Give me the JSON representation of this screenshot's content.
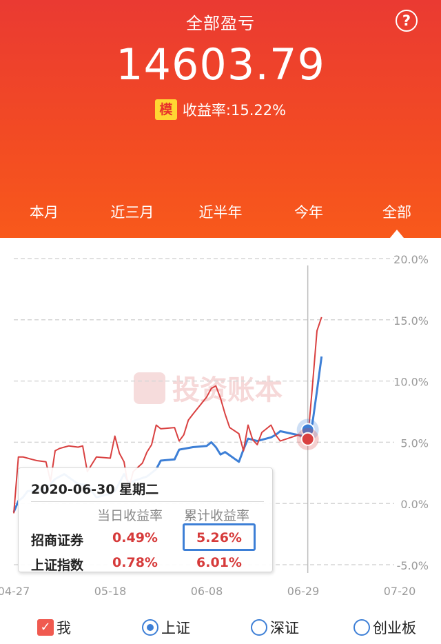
{
  "header": {
    "title": "全部盈亏",
    "help_icon_glyph": "?",
    "total": "14603.79",
    "mo_badge": "模",
    "yield_text": "收益率:15.22%"
  },
  "tabs": [
    {
      "label": "本月"
    },
    {
      "label": "近三月"
    },
    {
      "label": "近半年"
    },
    {
      "label": "今年"
    },
    {
      "label": "全部"
    }
  ],
  "watermark": "投资账本",
  "chart_data": {
    "type": "line",
    "ylim": [
      -5,
      20
    ],
    "yticks": [
      "20.0%",
      "15.0%",
      "10.0%",
      "5.0%",
      "0.0%",
      "-5.0%"
    ],
    "xticks": [
      "04-27",
      "05-18",
      "06-08",
      "06-29",
      "07-20"
    ],
    "grid": true,
    "xlim": [
      "2020-04-27",
      "2020-07-26"
    ],
    "series": [
      {
        "name": "我",
        "color": "#d94040",
        "points": [
          [
            "2020-04-27",
            -0.8
          ],
          [
            "2020-04-28",
            3.8
          ],
          [
            "2020-04-29",
            3.8
          ],
          [
            "2020-04-30",
            3.7
          ],
          [
            "2020-05-01",
            3.6
          ],
          [
            "2020-05-02",
            3.5
          ],
          [
            "2020-05-04",
            3.4
          ],
          [
            "2020-05-05",
            1.8
          ],
          [
            "2020-05-06",
            4.3
          ],
          [
            "2020-05-07",
            4.5
          ],
          [
            "2020-05-08",
            4.6
          ],
          [
            "2020-05-09",
            4.7
          ],
          [
            "2020-05-11",
            4.6
          ],
          [
            "2020-05-12",
            4.7
          ],
          [
            "2020-05-13",
            2.6
          ],
          [
            "2020-05-14",
            3.2
          ],
          [
            "2020-05-15",
            3.8
          ],
          [
            "2020-05-18",
            3.7
          ],
          [
            "2020-05-19",
            5.5
          ],
          [
            "2020-05-20",
            4.1
          ],
          [
            "2020-05-21",
            3.4
          ],
          [
            "2020-05-22",
            1.2
          ],
          [
            "2020-05-23",
            2.6
          ],
          [
            "2020-05-25",
            3.3
          ],
          [
            "2020-05-26",
            4.2
          ],
          [
            "2020-05-27",
            4.8
          ],
          [
            "2020-05-28",
            6.4
          ],
          [
            "2020-05-29",
            6.1
          ],
          [
            "2020-06-01",
            6.2
          ],
          [
            "2020-06-02",
            5.1
          ],
          [
            "2020-06-03",
            5.6
          ],
          [
            "2020-06-04",
            6.8
          ],
          [
            "2020-06-05",
            7.3
          ],
          [
            "2020-06-08",
            8.7
          ],
          [
            "2020-06-09",
            9.4
          ],
          [
            "2020-06-10",
            9.6
          ],
          [
            "2020-06-11",
            8.6
          ],
          [
            "2020-06-12",
            7.3
          ],
          [
            "2020-06-13",
            6.2
          ],
          [
            "2020-06-15",
            5.7
          ],
          [
            "2020-06-16",
            4.3
          ],
          [
            "2020-06-17",
            6.4
          ],
          [
            "2020-06-18",
            5.2
          ],
          [
            "2020-06-19",
            4.8
          ],
          [
            "2020-06-20",
            5.8
          ],
          [
            "2020-06-22",
            6.4
          ],
          [
            "2020-06-23",
            5.6
          ],
          [
            "2020-06-24",
            5.1
          ],
          [
            "2020-06-28",
            5.6
          ],
          [
            "2020-06-29",
            5.4
          ],
          [
            "2020-06-30",
            5.26
          ],
          [
            "2020-07-01",
            9.5
          ],
          [
            "2020-07-02",
            14.1
          ],
          [
            "2020-07-03",
            15.22
          ]
        ]
      },
      {
        "name": "上证",
        "color": "#3d7fd6",
        "points": [
          [
            "2020-04-27",
            -0.7
          ],
          [
            "2020-04-28",
            0.2
          ],
          [
            "2020-04-29",
            0.5
          ],
          [
            "2020-04-30",
            1.0
          ],
          [
            "2020-05-04",
            1.2
          ],
          [
            "2020-05-05",
            1.6
          ],
          [
            "2020-05-06",
            2.0
          ],
          [
            "2020-05-07",
            2.2
          ],
          [
            "2020-05-08",
            2.4
          ],
          [
            "2020-05-11",
            1.6
          ],
          [
            "2020-05-13",
            1.5
          ],
          [
            "2020-05-15",
            0.5
          ],
          [
            "2020-05-18",
            0.8
          ],
          [
            "2020-05-19",
            1.0
          ],
          [
            "2020-05-21",
            2.4
          ],
          [
            "2020-05-22",
            1.7
          ],
          [
            "2020-05-26",
            2.2
          ],
          [
            "2020-05-28",
            2.8
          ],
          [
            "2020-05-29",
            3.5
          ],
          [
            "2020-06-01",
            3.6
          ],
          [
            "2020-06-02",
            4.4
          ],
          [
            "2020-06-05",
            4.6
          ],
          [
            "2020-06-08",
            4.7
          ],
          [
            "2020-06-09",
            5.0
          ],
          [
            "2020-06-10",
            4.6
          ],
          [
            "2020-06-11",
            4.0
          ],
          [
            "2020-06-12",
            4.2
          ],
          [
            "2020-06-15",
            3.4
          ],
          [
            "2020-06-16",
            4.4
          ],
          [
            "2020-06-17",
            5.3
          ],
          [
            "2020-06-18",
            5.2
          ],
          [
            "2020-06-19",
            5.1
          ],
          [
            "2020-06-22",
            5.4
          ],
          [
            "2020-06-23",
            5.6
          ],
          [
            "2020-06-24",
            5.9
          ],
          [
            "2020-06-29",
            5.5
          ],
          [
            "2020-06-30",
            6.01
          ],
          [
            "2020-07-01",
            6.5
          ],
          [
            "2020-07-02",
            9.2
          ],
          [
            "2020-07-03",
            12.0
          ]
        ]
      }
    ],
    "highlight": "2020-06-30"
  },
  "tooltip": {
    "date": "2020-06-30 星期二",
    "col1_header": "当日收益率",
    "col2_header": "累计收益率",
    "row1_label": "招商证券",
    "row1_daily": "0.49%",
    "row1_cum": "5.26%",
    "row2_label": "上证指数",
    "row2_daily": "0.78%",
    "row2_cum": "6.01%"
  },
  "legend": {
    "me_label": "我",
    "sh_label": "上证",
    "sz_label": "深证",
    "cyb_label": "创业板",
    "check_glyph": "✓"
  },
  "colors": {
    "accent_red": "#ea3a32",
    "my_line": "#d94040",
    "index_line": "#3d7fd6"
  }
}
